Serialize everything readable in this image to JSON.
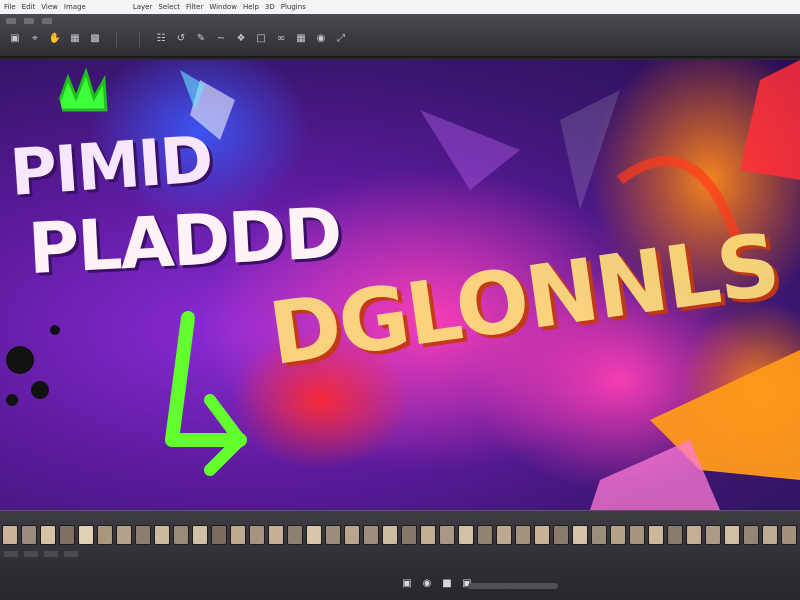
{
  "menubar": {
    "items": [
      "File",
      "Edit",
      "View",
      "Image",
      "Layer",
      "Select",
      "Filter",
      "Window",
      "Help",
      "3D",
      "Plugins"
    ]
  },
  "canvas": {
    "title_line1": "PIMID",
    "title_line2": "PLADDD",
    "title_line3": "DGLONNLS"
  },
  "filmstrip": {
    "thumb_colors": [
      "#c9b49a",
      "#9c8a7d",
      "#d6c2a5",
      "#7f6f64",
      "#e0d0b8",
      "#a9967f",
      "#b4a28c",
      "#8e7d6e",
      "#cdb99e",
      "#9a8878",
      "#d1bfa6",
      "#7c6c60",
      "#bfa98f",
      "#a6947f",
      "#c6b197",
      "#8f7f71",
      "#dac6ad",
      "#9d8b7b",
      "#b9a58d",
      "#a08d7c",
      "#cfbb9f",
      "#887769",
      "#c2ad93",
      "#ab9883",
      "#d4c0a7",
      "#938272",
      "#bca88f",
      "#a5927e",
      "#c8b399",
      "#8c7b6c",
      "#d7c3aa",
      "#9f8d7c",
      "#b6a28a",
      "#a7947f",
      "#ccb89d",
      "#8a7a6b",
      "#c4af95",
      "#ad9a85",
      "#d2bea4",
      "#968575",
      "#bfab92",
      "#a4917d",
      "#cab69b",
      "#8d7c6d",
      "#d5c1a8",
      "#9b8979",
      "#b8a48b"
    ]
  }
}
